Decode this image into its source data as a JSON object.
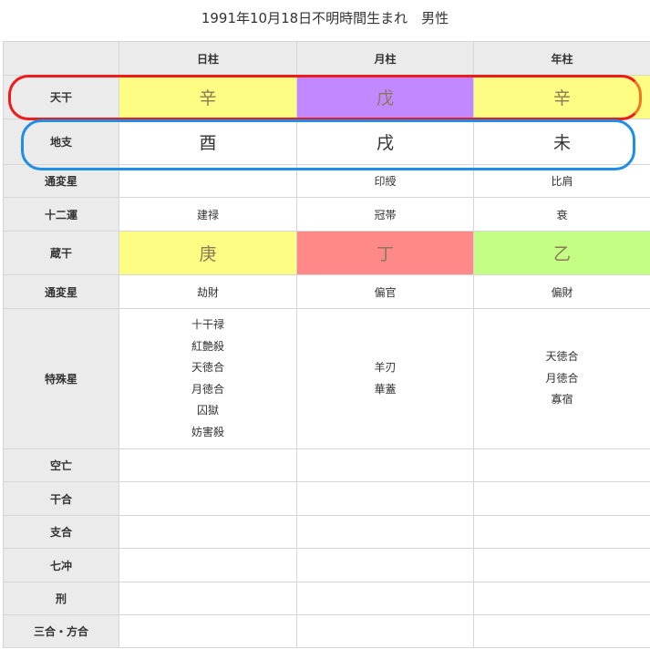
{
  "title": "1991年10月18日不明時間生まれ　男性",
  "columns": [
    "",
    "日柱",
    "月柱",
    "年柱"
  ],
  "rows": {
    "tenkan": {
      "label": "天干",
      "cells": [
        "辛",
        "戊",
        "辛"
      ],
      "colors": [
        "#fdfd84",
        "#c188ff",
        "#fdfd84"
      ]
    },
    "chishi": {
      "label": "地支",
      "cells": [
        "酉",
        "戌",
        "未"
      ]
    },
    "tsuhen1": {
      "label": "通変星",
      "cells": [
        "",
        "印綬",
        "比肩"
      ]
    },
    "juuni": {
      "label": "十二運",
      "cells": [
        "建禄",
        "冠帯",
        "衰"
      ]
    },
    "zoukan": {
      "label": "蔵干",
      "cells": [
        "庚",
        "丁",
        "乙"
      ],
      "colors": [
        "#fdfd84",
        "#ff8888",
        "#c4fe84"
      ]
    },
    "tsuhen2": {
      "label": "通変星",
      "cells": [
        "劫財",
        "偏官",
        "偏財"
      ]
    },
    "tokushu": {
      "label": "特殊星",
      "day": [
        "十干禄",
        "紅艶殺",
        "天徳合",
        "月徳合",
        "囚獄",
        "妨害殺"
      ],
      "month": [
        "羊刃",
        "華蓋"
      ],
      "year": [
        "天徳合",
        "月徳合",
        "寡宿"
      ]
    },
    "kuubou": {
      "label": "空亡"
    },
    "kangou": {
      "label": "干合"
    },
    "shigou": {
      "label": "支合"
    },
    "shichichuu": {
      "label": "七冲"
    },
    "kei": {
      "label": "刑"
    },
    "sangou": {
      "label": "三合・方合"
    }
  },
  "highlight_colors": {
    "ring_tenkan": "#ee1c1c",
    "ring_chishi": "#1f8ee8"
  }
}
